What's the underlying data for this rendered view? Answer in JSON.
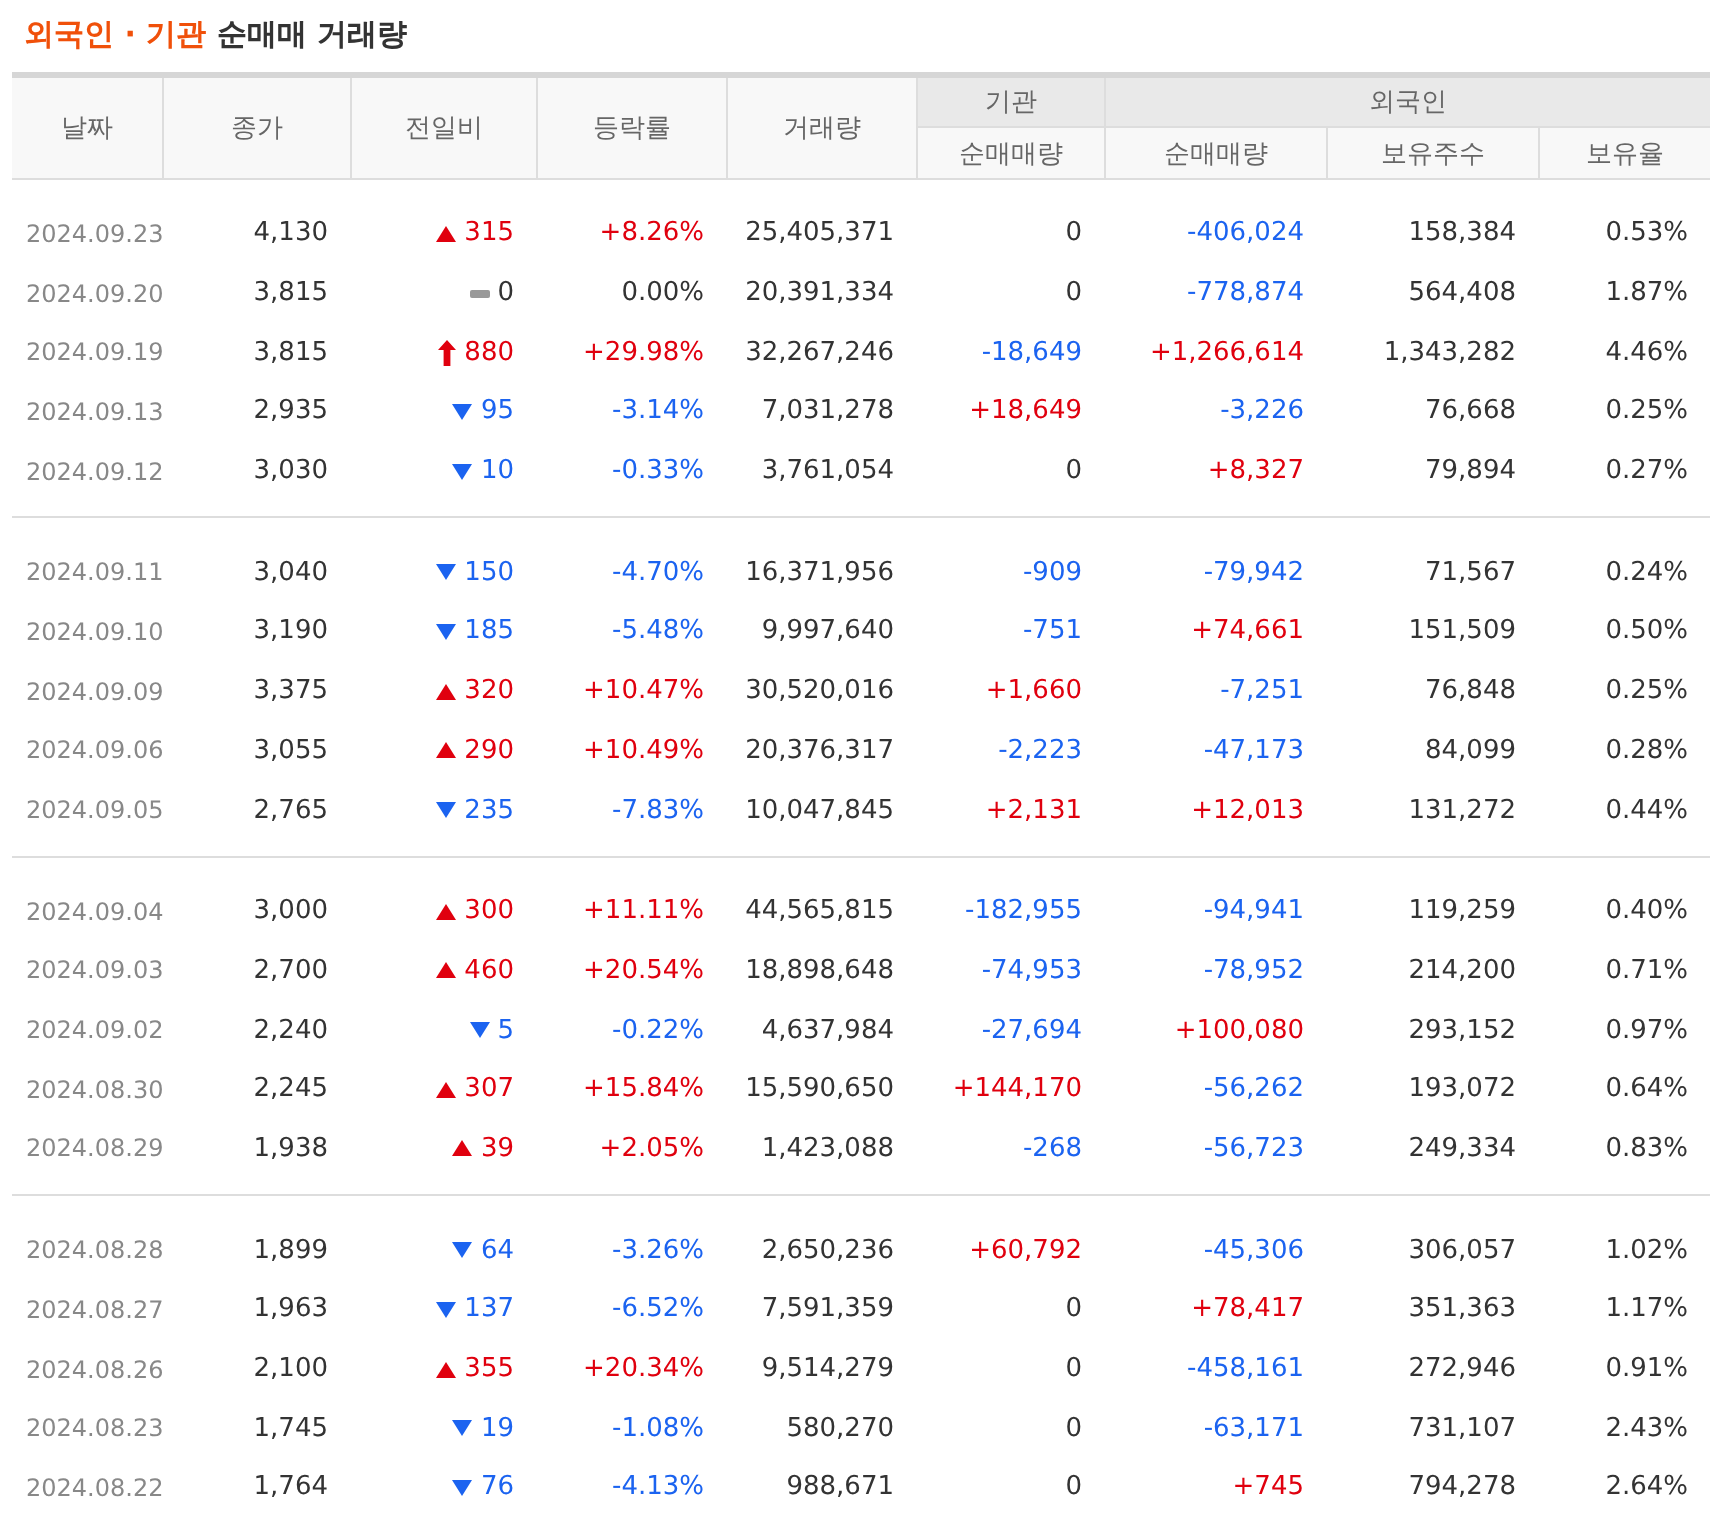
{
  "title": {
    "highlight": "외국인 · 기관",
    "rest": "순매매 거래량"
  },
  "columns": {
    "date": "날짜",
    "close": "종가",
    "change": "전일비",
    "rate": "등락률",
    "volume": "거래량",
    "institution": "기관",
    "institution_net": "순매매량",
    "foreign": "외국인",
    "foreign_net": "순매매량",
    "foreign_holdings": "보유주수",
    "foreign_ratio": "보유율"
  },
  "groups": [
    {
      "rows": [
        {
          "date": "2024.09.23",
          "close": "4,130",
          "kind": "up",
          "change": "315",
          "rate": "+8.26%",
          "volume": "25,405,371",
          "institution_net": {
            "value": "0",
            "kind": "flat"
          },
          "foreign_net": {
            "value": "-406,024",
            "kind": "down"
          },
          "foreign_holdings": "158,384",
          "foreign_ratio": "0.53%"
        },
        {
          "date": "2024.09.20",
          "close": "3,815",
          "kind": "flat",
          "change": "0",
          "rate": "0.00%",
          "volume": "20,391,334",
          "institution_net": {
            "value": "0",
            "kind": "flat"
          },
          "foreign_net": {
            "value": "-778,874",
            "kind": "down"
          },
          "foreign_holdings": "564,408",
          "foreign_ratio": "1.87%"
        },
        {
          "date": "2024.09.19",
          "close": "3,815",
          "kind": "limit_up",
          "change": "880",
          "rate": "+29.98%",
          "volume": "32,267,246",
          "institution_net": {
            "value": "-18,649",
            "kind": "down"
          },
          "foreign_net": {
            "value": "+1,266,614",
            "kind": "up"
          },
          "foreign_holdings": "1,343,282",
          "foreign_ratio": "4.46%"
        },
        {
          "date": "2024.09.13",
          "close": "2,935",
          "kind": "down",
          "change": "95",
          "rate": "-3.14%",
          "volume": "7,031,278",
          "institution_net": {
            "value": "+18,649",
            "kind": "up"
          },
          "foreign_net": {
            "value": "-3,226",
            "kind": "down"
          },
          "foreign_holdings": "76,668",
          "foreign_ratio": "0.25%"
        },
        {
          "date": "2024.09.12",
          "close": "3,030",
          "kind": "down",
          "change": "10",
          "rate": "-0.33%",
          "volume": "3,761,054",
          "institution_net": {
            "value": "0",
            "kind": "flat"
          },
          "foreign_net": {
            "value": "+8,327",
            "kind": "up"
          },
          "foreign_holdings": "79,894",
          "foreign_ratio": "0.27%"
        }
      ]
    },
    {
      "rows": [
        {
          "date": "2024.09.11",
          "close": "3,040",
          "kind": "down",
          "change": "150",
          "rate": "-4.70%",
          "volume": "16,371,956",
          "institution_net": {
            "value": "-909",
            "kind": "down"
          },
          "foreign_net": {
            "value": "-79,942",
            "kind": "down"
          },
          "foreign_holdings": "71,567",
          "foreign_ratio": "0.24%"
        },
        {
          "date": "2024.09.10",
          "close": "3,190",
          "kind": "down",
          "change": "185",
          "rate": "-5.48%",
          "volume": "9,997,640",
          "institution_net": {
            "value": "-751",
            "kind": "down"
          },
          "foreign_net": {
            "value": "+74,661",
            "kind": "up"
          },
          "foreign_holdings": "151,509",
          "foreign_ratio": "0.50%"
        },
        {
          "date": "2024.09.09",
          "close": "3,375",
          "kind": "up",
          "change": "320",
          "rate": "+10.47%",
          "volume": "30,520,016",
          "institution_net": {
            "value": "+1,660",
            "kind": "up"
          },
          "foreign_net": {
            "value": "-7,251",
            "kind": "down"
          },
          "foreign_holdings": "76,848",
          "foreign_ratio": "0.25%"
        },
        {
          "date": "2024.09.06",
          "close": "3,055",
          "kind": "up",
          "change": "290",
          "rate": "+10.49%",
          "volume": "20,376,317",
          "institution_net": {
            "value": "-2,223",
            "kind": "down"
          },
          "foreign_net": {
            "value": "-47,173",
            "kind": "down"
          },
          "foreign_holdings": "84,099",
          "foreign_ratio": "0.28%"
        },
        {
          "date": "2024.09.05",
          "close": "2,765",
          "kind": "down",
          "change": "235",
          "rate": "-7.83%",
          "volume": "10,047,845",
          "institution_net": {
            "value": "+2,131",
            "kind": "up"
          },
          "foreign_net": {
            "value": "+12,013",
            "kind": "up"
          },
          "foreign_holdings": "131,272",
          "foreign_ratio": "0.44%"
        }
      ]
    },
    {
      "rows": [
        {
          "date": "2024.09.04",
          "close": "3,000",
          "kind": "up",
          "change": "300",
          "rate": "+11.11%",
          "volume": "44,565,815",
          "institution_net": {
            "value": "-182,955",
            "kind": "down"
          },
          "foreign_net": {
            "value": "-94,941",
            "kind": "down"
          },
          "foreign_holdings": "119,259",
          "foreign_ratio": "0.40%"
        },
        {
          "date": "2024.09.03",
          "close": "2,700",
          "kind": "up",
          "change": "460",
          "rate": "+20.54%",
          "volume": "18,898,648",
          "institution_net": {
            "value": "-74,953",
            "kind": "down"
          },
          "foreign_net": {
            "value": "-78,952",
            "kind": "down"
          },
          "foreign_holdings": "214,200",
          "foreign_ratio": "0.71%"
        },
        {
          "date": "2024.09.02",
          "close": "2,240",
          "kind": "down",
          "change": "5",
          "rate": "-0.22%",
          "volume": "4,637,984",
          "institution_net": {
            "value": "-27,694",
            "kind": "down"
          },
          "foreign_net": {
            "value": "+100,080",
            "kind": "up"
          },
          "foreign_holdings": "293,152",
          "foreign_ratio": "0.97%"
        },
        {
          "date": "2024.08.30",
          "close": "2,245",
          "kind": "up",
          "change": "307",
          "rate": "+15.84%",
          "volume": "15,590,650",
          "institution_net": {
            "value": "+144,170",
            "kind": "up"
          },
          "foreign_net": {
            "value": "-56,262",
            "kind": "down"
          },
          "foreign_holdings": "193,072",
          "foreign_ratio": "0.64%"
        },
        {
          "date": "2024.08.29",
          "close": "1,938",
          "kind": "up",
          "change": "39",
          "rate": "+2.05%",
          "volume": "1,423,088",
          "institution_net": {
            "value": "-268",
            "kind": "down"
          },
          "foreign_net": {
            "value": "-56,723",
            "kind": "down"
          },
          "foreign_holdings": "249,334",
          "foreign_ratio": "0.83%"
        }
      ]
    },
    {
      "rows": [
        {
          "date": "2024.08.28",
          "close": "1,899",
          "kind": "down",
          "change": "64",
          "rate": "-3.26%",
          "volume": "2,650,236",
          "institution_net": {
            "value": "+60,792",
            "kind": "up"
          },
          "foreign_net": {
            "value": "-45,306",
            "kind": "down"
          },
          "foreign_holdings": "306,057",
          "foreign_ratio": "1.02%"
        },
        {
          "date": "2024.08.27",
          "close": "1,963",
          "kind": "down",
          "change": "137",
          "rate": "-6.52%",
          "volume": "7,591,359",
          "institution_net": {
            "value": "0",
            "kind": "flat"
          },
          "foreign_net": {
            "value": "+78,417",
            "kind": "up"
          },
          "foreign_holdings": "351,363",
          "foreign_ratio": "1.17%"
        },
        {
          "date": "2024.08.26",
          "close": "2,100",
          "kind": "up",
          "change": "355",
          "rate": "+20.34%",
          "volume": "9,514,279",
          "institution_net": {
            "value": "0",
            "kind": "flat"
          },
          "foreign_net": {
            "value": "-458,161",
            "kind": "down"
          },
          "foreign_holdings": "272,946",
          "foreign_ratio": "0.91%"
        },
        {
          "date": "2024.08.23",
          "close": "1,745",
          "kind": "down",
          "change": "19",
          "rate": "-1.08%",
          "volume": "580,270",
          "institution_net": {
            "value": "0",
            "kind": "flat"
          },
          "foreign_net": {
            "value": "-63,171",
            "kind": "down"
          },
          "foreign_holdings": "731,107",
          "foreign_ratio": "2.43%"
        },
        {
          "date": "2024.08.22",
          "close": "1,764",
          "kind": "down",
          "change": "76",
          "rate": "-4.13%",
          "volume": "988,671",
          "institution_net": {
            "value": "0",
            "kind": "flat"
          },
          "foreign_net": {
            "value": "+745",
            "kind": "up"
          },
          "foreign_holdings": "794,278",
          "foreign_ratio": "2.64%"
        }
      ]
    }
  ]
}
